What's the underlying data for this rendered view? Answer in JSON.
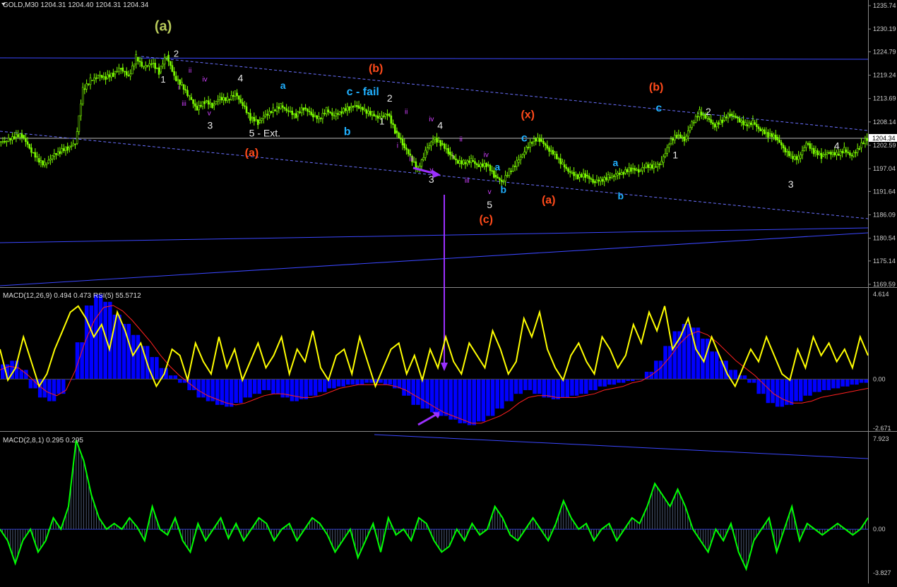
{
  "header": {
    "title": "GOLD,M30  1204.31 1204.40 1204.31 1204.34",
    "macd_title": "MACD(12,26,9) 0.494 0.473  RSI(5) 55.5712",
    "macd2_title": "MACD(2,8,1) 0.295 0.295"
  },
  "price_axis": {
    "ticks": [
      "1235.74",
      "1230.19",
      "1224.79",
      "1219.24",
      "1213.69",
      "1208.14",
      "1202.59",
      "1197.04",
      "1191.64",
      "1186.09",
      "1180.54",
      "1175.14",
      "1169.59"
    ],
    "current": "1204.34"
  },
  "macd_axis": {
    "ticks": [
      "4.614",
      "0.00",
      "-2.671"
    ]
  },
  "macd2_axis": {
    "ticks": [
      "7.923",
      "0.00",
      "-3.827"
    ]
  },
  "colors": {
    "background": "#000000",
    "candles": "#7CFC00",
    "grid": "#2a2a2a",
    "trendline": "#3b47ff",
    "macd_hist": "#0000ff",
    "macd_signal": "#ff2020",
    "rsi": "#ffff00",
    "macd2": "#00ff00",
    "arrow": "#9b30ff",
    "wave_white": "#e8e8e8",
    "wave_orange": "#ff4a1a",
    "wave_cyan": "#20b0ff",
    "wave_purple": "#d040ff",
    "wave_olive": "#b7c95a"
  },
  "chart_data": {
    "type": "candlestick",
    "symbol": "GOLD",
    "timeframe": "M30",
    "ylim": [
      1169.59,
      1235.74
    ],
    "close_series": [
      1203.5,
      1204.5,
      1205.0,
      1202.0,
      1199.5,
      1198.0,
      1200.0,
      1201.0,
      1202.0,
      1203.0,
      1216.0,
      1218.0,
      1219.0,
      1218.5,
      1219.5,
      1221.0,
      1219.0,
      1223.5,
      1221.0,
      1222.0,
      1220.0,
      1224.0,
      1219.0,
      1217.0,
      1214.0,
      1211.0,
      1213.0,
      1212.0,
      1214.0,
      1213.5,
      1215.0,
      1212.0,
      1209.0,
      1208.0,
      1210.0,
      1211.0,
      1212.0,
      1210.5,
      1209.5,
      1211.5,
      1210.0,
      1209.0,
      1211.0,
      1209.5,
      1210.5,
      1211.5,
      1212.0,
      1211.0,
      1210.0,
      1209.0,
      1210.0,
      1206.0,
      1203.0,
      1200.0,
      1197.0,
      1201.0,
      1204.0,
      1203.0,
      1201.0,
      1199.0,
      1198.5,
      1199.0,
      1197.5,
      1198.0,
      1195.5,
      1194.0,
      1196.5,
      1198.5,
      1201.0,
      1203.5,
      1204.0,
      1202.0,
      1200.5,
      1198.0,
      1196.0,
      1195.0,
      1195.5,
      1194.0,
      1194.5,
      1195.0,
      1195.5,
      1196.0,
      1197.0,
      1196.5,
      1198.0,
      1197.5,
      1198.5,
      1203.0,
      1205.0,
      1204.0,
      1208.0,
      1210.5,
      1209.0,
      1207.0,
      1208.5,
      1210.0,
      1209.0,
      1207.5,
      1208.0,
      1206.0,
      1205.0,
      1204.5,
      1202.0,
      1200.0,
      1199.5,
      1203.0,
      1201.0,
      1200.0,
      1201.0,
      1200.5,
      1201.5,
      1200.0,
      1202.0,
      1204.3
    ],
    "rsi_series": [
      60,
      35,
      45,
      70,
      50,
      30,
      40,
      60,
      75,
      90,
      95,
      85,
      70,
      80,
      60,
      90,
      75,
      55,
      65,
      45,
      30,
      40,
      60,
      55,
      35,
      65,
      50,
      40,
      70,
      45,
      60,
      35,
      50,
      65,
      45,
      55,
      70,
      40,
      60,
      50,
      75,
      45,
      35,
      55,
      60,
      40,
      70,
      50,
      30,
      45,
      60,
      65,
      40,
      55,
      35,
      60,
      45,
      70,
      50,
      40,
      65,
      55,
      45,
      75,
      60,
      40,
      50,
      85,
      70,
      90,
      60,
      45,
      35,
      55,
      65,
      50,
      40,
      70,
      60,
      45,
      55,
      80,
      65,
      90,
      75,
      95,
      60,
      70,
      85,
      60,
      50,
      70,
      55,
      40,
      30,
      45,
      60,
      50,
      70,
      55,
      40,
      35,
      60,
      45,
      70,
      55,
      65,
      50,
      60,
      45,
      70,
      55
    ],
    "macd_hist_series": [
      0.8,
      1.0,
      0.5,
      -0.5,
      -1.0,
      -1.2,
      -0.8,
      0,
      2,
      4,
      4.6,
      4.2,
      3.5,
      3.0,
      2.4,
      1.8,
      1.2,
      0.6,
      0.2,
      -0.2,
      -0.6,
      -1.0,
      -1.2,
      -1.4,
      -1.5,
      -1.3,
      -1.0,
      -0.8,
      -0.6,
      -0.8,
      -1.0,
      -1.2,
      -1.1,
      -0.9,
      -0.7,
      -0.5,
      -0.4,
      -0.3,
      -0.3,
      -0.2,
      -0.2,
      -0.3,
      -0.5,
      -0.9,
      -1.4,
      -1.6,
      -1.8,
      -2.0,
      -2.2,
      -2.4,
      -2.5,
      -2.3,
      -2.0,
      -1.6,
      -1.2,
      -0.8,
      -0.6,
      -0.8,
      -1.0,
      -1.1,
      -1.0,
      -0.9,
      -0.8,
      -0.6,
      -0.4,
      -0.3,
      -0.2,
      -0.1,
      0,
      0.4,
      1.0,
      1.8,
      2.6,
      3.0,
      2.8,
      2.2,
      1.5,
      1.0,
      0.5,
      0.2,
      -0.2,
      -0.8,
      -1.3,
      -1.5,
      -1.4,
      -1.2,
      -0.9,
      -0.7,
      -0.6,
      -0.5,
      -0.4,
      -0.3,
      -0.2
    ],
    "macd_signal_series": [
      0.5,
      0.7,
      0.6,
      0.2,
      -0.3,
      -0.7,
      -0.9,
      -0.6,
      0.5,
      2.0,
      3.2,
      3.9,
      4.0,
      3.7,
      3.2,
      2.6,
      2.0,
      1.3,
      0.7,
      0.2,
      -0.2,
      -0.6,
      -0.9,
      -1.1,
      -1.3,
      -1.4,
      -1.3,
      -1.1,
      -0.9,
      -0.8,
      -0.8,
      -0.9,
      -1.0,
      -1.0,
      -0.9,
      -0.7,
      -0.5,
      -0.4,
      -0.3,
      -0.3,
      -0.3,
      -0.3,
      -0.4,
      -0.6,
      -0.9,
      -1.2,
      -1.5,
      -1.8,
      -2.0,
      -2.2,
      -2.4,
      -2.4,
      -2.2,
      -2.0,
      -1.7,
      -1.3,
      -1.0,
      -0.9,
      -0.9,
      -1.0,
      -1.0,
      -1.0,
      -0.9,
      -0.8,
      -0.6,
      -0.5,
      -0.4,
      -0.2,
      -0.1,
      0.2,
      0.6,
      1.2,
      1.9,
      2.4,
      2.6,
      2.4,
      2.0,
      1.5,
      1.0,
      0.6,
      0.2,
      -0.3,
      -0.8,
      -1.1,
      -1.3,
      -1.3,
      -1.2,
      -1.0,
      -0.9,
      -0.8,
      -0.7,
      -0.6,
      -0.5
    ],
    "macd2_series": [
      0,
      -1,
      -3,
      -1,
      0,
      -2,
      -1,
      1,
      0,
      2,
      7.8,
      6,
      3,
      1,
      0,
      0.5,
      0,
      1,
      0.2,
      -1,
      2,
      0,
      -0.5,
      1,
      -1,
      -2,
      0.5,
      -1,
      0,
      1,
      -0.8,
      0.5,
      -1,
      0,
      1,
      0.5,
      -1,
      0,
      0.5,
      -1,
      0,
      1,
      0.5,
      -0.5,
      -2,
      -1,
      0,
      -2.5,
      -1,
      0.5,
      -2,
      1,
      -0.5,
      0,
      -1,
      1,
      0.5,
      -1,
      -2,
      -1.5,
      0,
      -1,
      0.5,
      -0.5,
      0,
      2,
      1,
      -0.5,
      -1,
      0,
      1,
      0,
      -1,
      0.5,
      2.5,
      1,
      0,
      0.5,
      -1,
      0,
      0.5,
      -1,
      0,
      1,
      0.5,
      2,
      4,
      3,
      2,
      3.5,
      2,
      0,
      -1,
      -2,
      0,
      -1,
      0.5,
      -2,
      -3.5,
      -1,
      0,
      1,
      -2,
      0,
      2,
      -1,
      0.5,
      0,
      -0.5,
      0,
      0.5,
      0,
      -0.5,
      0,
      1
    ]
  },
  "wave_labels": [
    {
      "t": "(a)",
      "c": "wave_olive",
      "ix": 0.188,
      "p": 1229.8,
      "s": 20
    },
    {
      "t": "2",
      "c": "wave_white",
      "ix": 0.203,
      "p": 1223.6,
      "s": 13
    },
    {
      "t": "1",
      "c": "wave_white",
      "ix": 0.188,
      "p": 1217.5,
      "s": 13
    },
    {
      "t": "ii",
      "c": "wave_purple",
      "ix": 0.219,
      "p": 1219.8,
      "s": 10
    },
    {
      "t": "i",
      "c": "wave_purple",
      "ix": 0.206,
      "p": 1215.8,
      "s": 10
    },
    {
      "t": "iv",
      "c": "wave_purple",
      "ix": 0.236,
      "p": 1217.7,
      "s": 10
    },
    {
      "t": "iii",
      "c": "wave_purple",
      "ix": 0.212,
      "p": 1212.0,
      "s": 10
    },
    {
      "t": "v",
      "c": "wave_purple",
      "ix": 0.241,
      "p": 1209.7,
      "s": 10
    },
    {
      "t": "4",
      "c": "wave_white",
      "ix": 0.277,
      "p": 1217.7,
      "s": 14
    },
    {
      "t": "3",
      "c": "wave_white",
      "ix": 0.242,
      "p": 1206.5,
      "s": 14
    },
    {
      "t": "5 - Ext.",
      "c": "wave_white",
      "ix": 0.305,
      "p": 1204.7,
      "s": 14
    },
    {
      "t": "(a)",
      "c": "wave_orange",
      "ix": 0.29,
      "p": 1200.0,
      "s": 16
    },
    {
      "t": "a",
      "c": "wave_cyan",
      "ix": 0.326,
      "p": 1216.0,
      "s": 14
    },
    {
      "t": "(b)",
      "c": "wave_orange",
      "ix": 0.433,
      "p": 1220.0,
      "s": 16
    },
    {
      "t": "c - fail",
      "c": "wave_cyan",
      "ix": 0.418,
      "p": 1214.5,
      "s": 16
    },
    {
      "t": "b",
      "c": "wave_cyan",
      "ix": 0.4,
      "p": 1205.0,
      "s": 16
    },
    {
      "t": "2",
      "c": "wave_white",
      "ix": 0.449,
      "p": 1213.0,
      "s": 14
    },
    {
      "t": "1",
      "c": "wave_white",
      "ix": 0.44,
      "p": 1207.5,
      "s": 13
    },
    {
      "t": "ii",
      "c": "wave_purple",
      "ix": 0.468,
      "p": 1210.0,
      "s": 10
    },
    {
      "t": "i",
      "c": "wave_purple",
      "ix": 0.458,
      "p": 1202.0,
      "s": 10
    },
    {
      "t": "iii",
      "c": "wave_purple",
      "ix": 0.474,
      "p": 1198.8,
      "s": 10
    },
    {
      "t": "iv",
      "c": "wave_purple",
      "ix": 0.497,
      "p": 1208.3,
      "s": 10
    },
    {
      "t": "4",
      "c": "wave_white",
      "ix": 0.507,
      "p": 1206.5,
      "s": 14
    },
    {
      "t": "v",
      "c": "wave_purple",
      "ix": 0.497,
      "p": 1196.2,
      "s": 10
    },
    {
      "t": "3",
      "c": "wave_white",
      "ix": 0.497,
      "p": 1193.7,
      "s": 14
    },
    {
      "t": "ii",
      "c": "wave_purple",
      "ix": 0.531,
      "p": 1203.5,
      "s": 10
    },
    {
      "t": "i",
      "c": "wave_purple",
      "ix": 0.522,
      "p": 1199.5,
      "s": 10
    },
    {
      "t": "iii",
      "c": "wave_purple",
      "ix": 0.538,
      "p": 1193.7,
      "s": 10
    },
    {
      "t": "iv",
      "c": "wave_purple",
      "ix": 0.56,
      "p": 1199.8,
      "s": 10
    },
    {
      "t": "a",
      "c": "wave_cyan",
      "ix": 0.573,
      "p": 1196.6,
      "s": 14
    },
    {
      "t": "v",
      "c": "wave_purple",
      "ix": 0.564,
      "p": 1191.0,
      "s": 10
    },
    {
      "t": "b",
      "c": "wave_cyan",
      "ix": 0.58,
      "p": 1191.3,
      "s": 14
    },
    {
      "t": "5",
      "c": "wave_white",
      "ix": 0.564,
      "p": 1187.7,
      "s": 14
    },
    {
      "t": "(c)",
      "c": "wave_orange",
      "ix": 0.56,
      "p": 1184.2,
      "s": 16
    },
    {
      "t": "(x)",
      "c": "wave_orange",
      "ix": 0.608,
      "p": 1209.0,
      "s": 16
    },
    {
      "t": "c",
      "c": "wave_cyan",
      "ix": 0.604,
      "p": 1203.5,
      "s": 16
    },
    {
      "t": "(a)",
      "c": "wave_orange",
      "ix": 0.632,
      "p": 1188.8,
      "s": 16
    },
    {
      "t": "a",
      "c": "wave_cyan",
      "ix": 0.709,
      "p": 1197.6,
      "s": 14
    },
    {
      "t": "b",
      "c": "wave_cyan",
      "ix": 0.715,
      "p": 1189.8,
      "s": 14
    },
    {
      "t": "(b)",
      "c": "wave_orange",
      "ix": 0.756,
      "p": 1215.6,
      "s": 16
    },
    {
      "t": "c",
      "c": "wave_cyan",
      "ix": 0.759,
      "p": 1210.6,
      "s": 16
    },
    {
      "t": "2",
      "c": "wave_white",
      "ix": 0.816,
      "p": 1209.8,
      "s": 14
    },
    {
      "t": "1",
      "c": "wave_white",
      "ix": 0.778,
      "p": 1199.5,
      "s": 14
    },
    {
      "t": "3",
      "c": "wave_white",
      "ix": 0.911,
      "p": 1192.5,
      "s": 14
    },
    {
      "t": "4",
      "c": "wave_white",
      "ix": 0.964,
      "p": 1201.7,
      "s": 14
    }
  ]
}
